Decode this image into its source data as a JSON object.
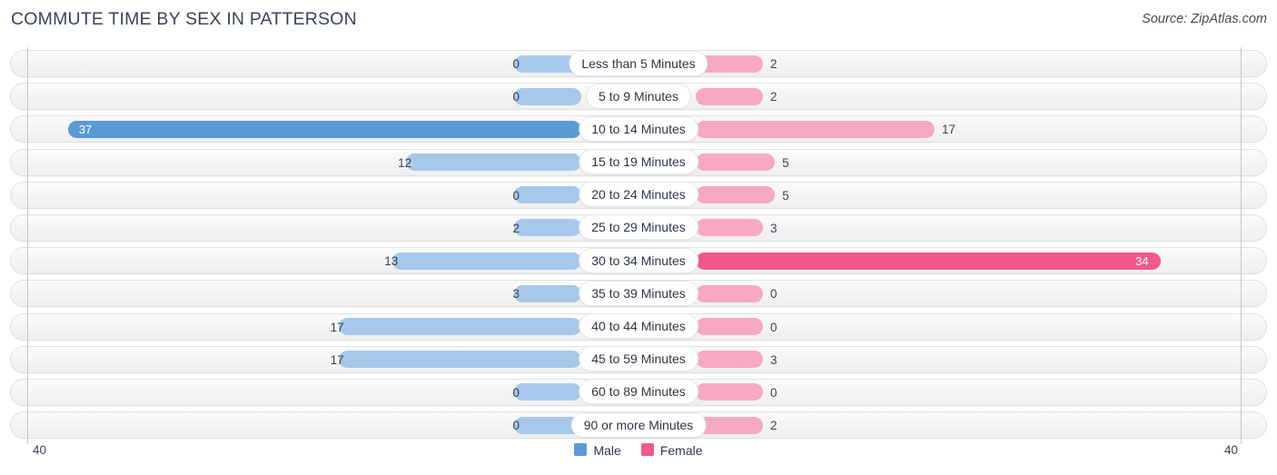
{
  "header": {
    "title": "COMMUTE TIME BY SEX IN PATTERSON",
    "source": "Source: ZipAtlas.com"
  },
  "legend": {
    "items": [
      {
        "label": "Male",
        "color": "#5b9bd5"
      },
      {
        "label": "Female",
        "color": "#f2588b"
      }
    ]
  },
  "axis": {
    "left_label": "40",
    "right_label": "40"
  },
  "colors": {
    "male_normal": "#a6c8ea",
    "male_max": "#5b9bd5",
    "female_normal": "#f7a8c4",
    "female_max": "#f2588b",
    "text": "#3c4454"
  },
  "chart_data": {
    "type": "bar",
    "subtype": "diverging-bar",
    "title": "COMMUTE TIME BY SEX IN PATTERSON",
    "xlabel": "",
    "ylabel": "",
    "xlim": [
      40,
      40
    ],
    "grid": false,
    "legend_position": "bottom-center",
    "categories": [
      "Less than 5 Minutes",
      "5 to 9 Minutes",
      "10 to 14 Minutes",
      "15 to 19 Minutes",
      "20 to 24 Minutes",
      "25 to 29 Minutes",
      "30 to 34 Minutes",
      "35 to 39 Minutes",
      "40 to 44 Minutes",
      "45 to 59 Minutes",
      "60 to 89 Minutes",
      "90 or more Minutes"
    ],
    "series": [
      {
        "name": "Male",
        "side": "left",
        "values": [
          0,
          0,
          37,
          12,
          0,
          2,
          13,
          3,
          17,
          17,
          0,
          0
        ]
      },
      {
        "name": "Female",
        "side": "right",
        "values": [
          2,
          2,
          17,
          5,
          5,
          3,
          34,
          0,
          0,
          3,
          0,
          2
        ]
      }
    ],
    "rows": [
      {
        "label": "Less than 5 Minutes",
        "male": 0,
        "male_text": "0",
        "female": 2,
        "female_text": "2"
      },
      {
        "label": "5 to 9 Minutes",
        "male": 0,
        "male_text": "0",
        "female": 2,
        "female_text": "2"
      },
      {
        "label": "10 to 14 Minutes",
        "male": 37,
        "male_text": "37",
        "female": 17,
        "female_text": "17"
      },
      {
        "label": "15 to 19 Minutes",
        "male": 12,
        "male_text": "12",
        "female": 5,
        "female_text": "5"
      },
      {
        "label": "20 to 24 Minutes",
        "male": 0,
        "male_text": "0",
        "female": 5,
        "female_text": "5"
      },
      {
        "label": "25 to 29 Minutes",
        "male": 2,
        "male_text": "2",
        "female": 3,
        "female_text": "3"
      },
      {
        "label": "30 to 34 Minutes",
        "male": 13,
        "male_text": "13",
        "female": 34,
        "female_text": "34"
      },
      {
        "label": "35 to 39 Minutes",
        "male": 3,
        "male_text": "3",
        "female": 0,
        "female_text": "0"
      },
      {
        "label": "40 to 44 Minutes",
        "male": 17,
        "male_text": "17",
        "female": 0,
        "female_text": "0"
      },
      {
        "label": "45 to 59 Minutes",
        "male": 17,
        "male_text": "17",
        "female": 3,
        "female_text": "3"
      },
      {
        "label": "60 to 89 Minutes",
        "male": 0,
        "male_text": "0",
        "female": 0,
        "female_text": "0"
      },
      {
        "label": "90 or more Minutes",
        "male": 0,
        "male_text": "0",
        "female": 2,
        "female_text": "2"
      }
    ]
  }
}
